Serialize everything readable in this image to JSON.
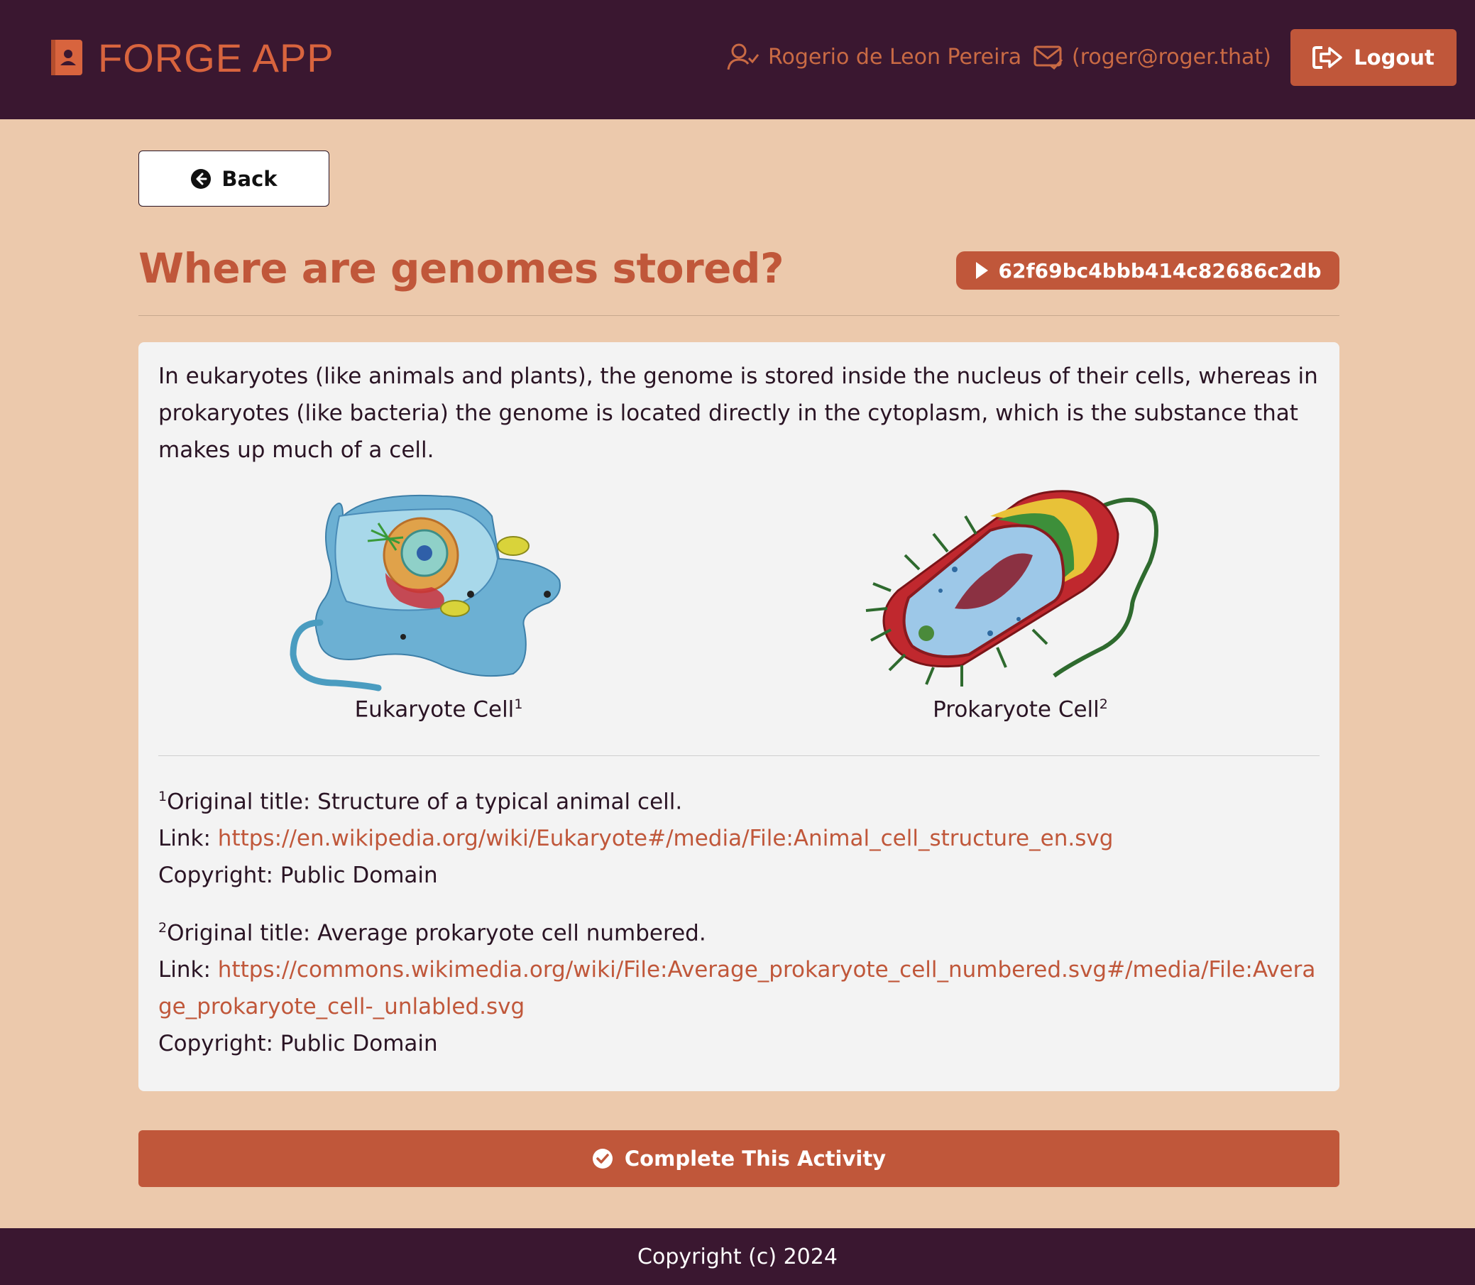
{
  "header": {
    "app_name": "FORGE APP",
    "user_name": "Rogerio de Leon Pereira",
    "user_email": "(roger@roger.that)",
    "logout_label": "Logout"
  },
  "nav": {
    "back_label": "Back"
  },
  "activity": {
    "title": "Where are genomes stored?",
    "id": "62f69bc4bbb414c82686c2db",
    "intro": "In eukaryotes (like animals and plants), the genome is stored inside the nucleus of their cells, whereas in prokaryotes (like bacteria) the genome is located directly in the cytoplasm, which is the substance that makes up much of a cell.",
    "figures": [
      {
        "caption": "Eukaryote Cell",
        "ref": "1"
      },
      {
        "caption": "Prokaryote Cell",
        "ref": "2"
      }
    ],
    "references": [
      {
        "num": "1",
        "title": "Original title: Structure of a typical animal cell.",
        "link_label": "Link: ",
        "link": "https://en.wikipedia.org/wiki/Eukaryote#/media/File:Animal_cell_structure_en.svg",
        "copyright": "Copyright: Public Domain"
      },
      {
        "num": "2",
        "title": "Original title: Average prokaryote cell numbered.",
        "link_label": "Link: ",
        "link": "https://commons.wikimedia.org/wiki/File:Average_prokaryote_cell_numbered.svg#/media/File:Average_prokaryote_cell-_unlabled.svg",
        "copyright": "Copyright: Public Domain"
      }
    ],
    "complete_label": "Complete This Activity"
  },
  "footer": {
    "copyright": "Copyright (c) 2024"
  },
  "colors": {
    "header_bg": "#3a1730",
    "page_bg": "#ecc9ac",
    "accent": "#c0573a",
    "card_bg": "#f3f3f3"
  }
}
